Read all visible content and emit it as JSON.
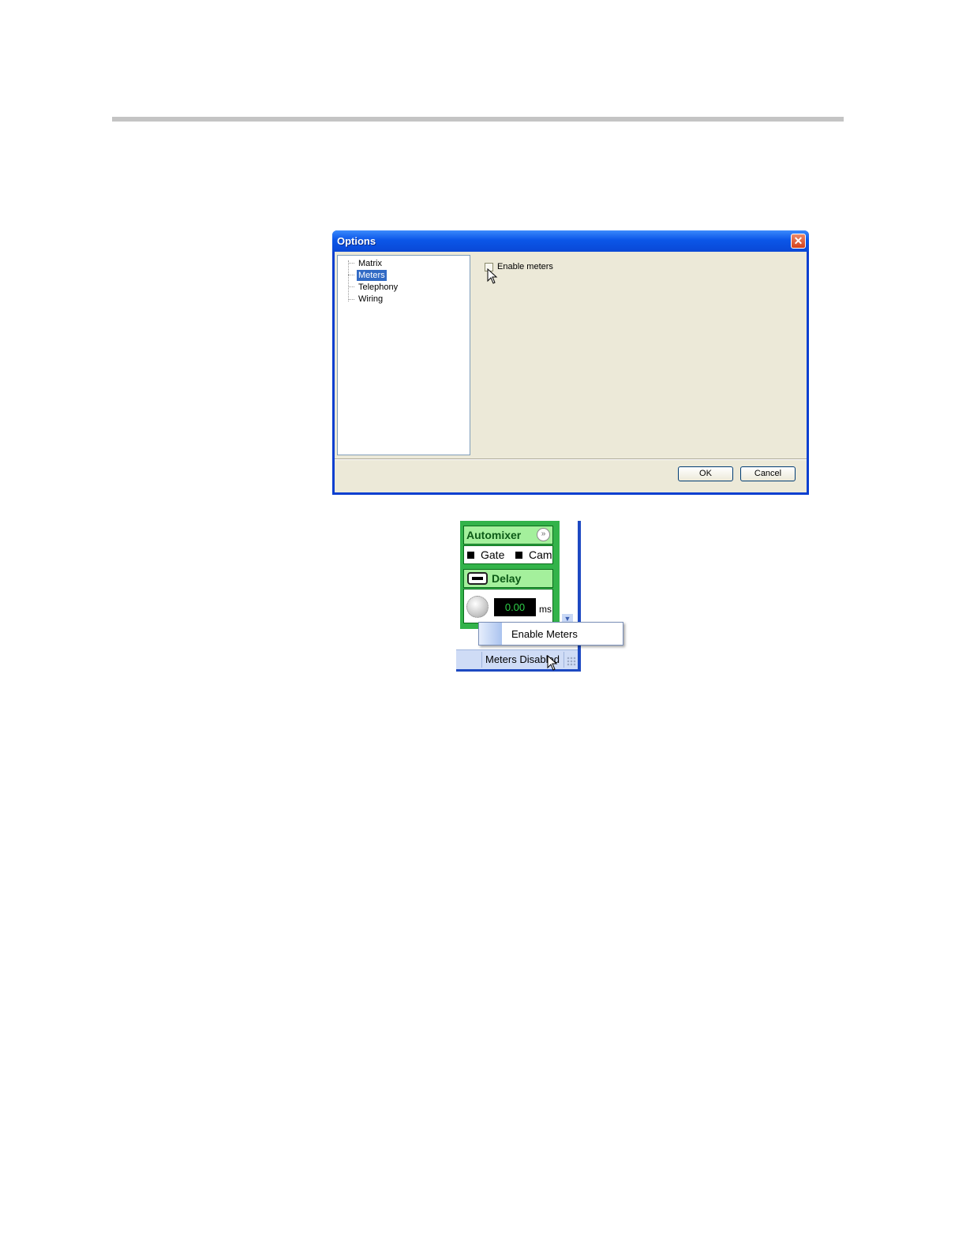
{
  "options_dialog": {
    "title": "Options",
    "close_glyph": "✕",
    "tree_items": [
      "Matrix",
      "Meters",
      "Telephony",
      "Wiring"
    ],
    "selected_item": "Meters",
    "enable_meters_checkbox": {
      "label": "Enable meters",
      "checked": false
    },
    "ok_label": "OK",
    "cancel_label": "Cancel"
  },
  "meters_panel": {
    "automixer": {
      "title": "Automixer",
      "gate_label": "Gate",
      "cam_label": "Cam",
      "chevron_glyph": "»"
    },
    "delay": {
      "title": "Delay",
      "value": "0.00",
      "unit": "ms"
    },
    "scroll_arrow_glyph": "▼",
    "context_menu": {
      "item_label": "Enable Meters"
    },
    "status_bar": {
      "text": "Meters Disabled"
    }
  },
  "colors": {
    "titlebar": "#0b56e8",
    "selection": "#316ac5",
    "panel_green": "#33b34a",
    "header_green": "#a4f09c"
  }
}
